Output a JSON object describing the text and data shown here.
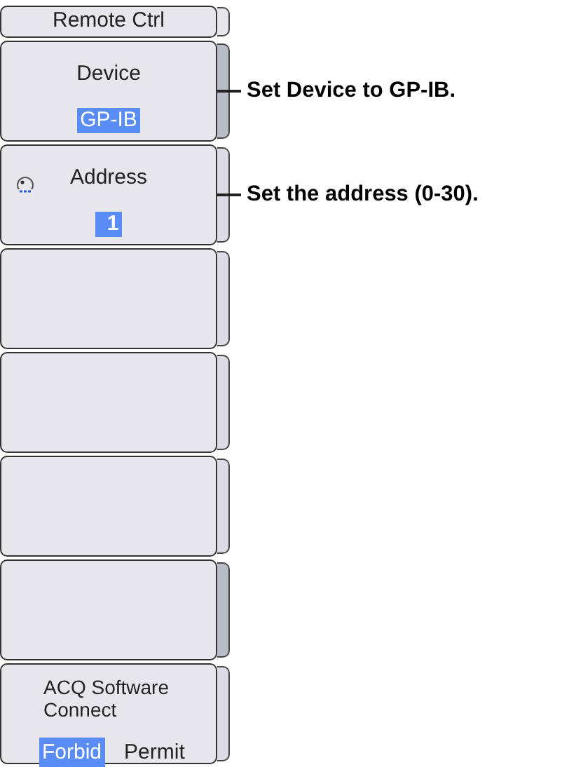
{
  "menu": {
    "title": "Remote Ctrl",
    "keys": [
      {
        "kind": "select",
        "label": "Device",
        "value": "GP-IB",
        "callout": "Set Device to GP-IB."
      },
      {
        "kind": "number",
        "label": "Address",
        "value": "1",
        "callout": "Set the address (0-30)."
      },
      {
        "kind": "empty"
      },
      {
        "kind": "empty"
      },
      {
        "kind": "empty"
      },
      {
        "kind": "empty"
      },
      {
        "kind": "toggle",
        "label": "ACQ Software Connect",
        "options": [
          {
            "label": "Forbid",
            "selected": true
          },
          {
            "label": "Permit",
            "selected": false
          }
        ]
      }
    ]
  }
}
